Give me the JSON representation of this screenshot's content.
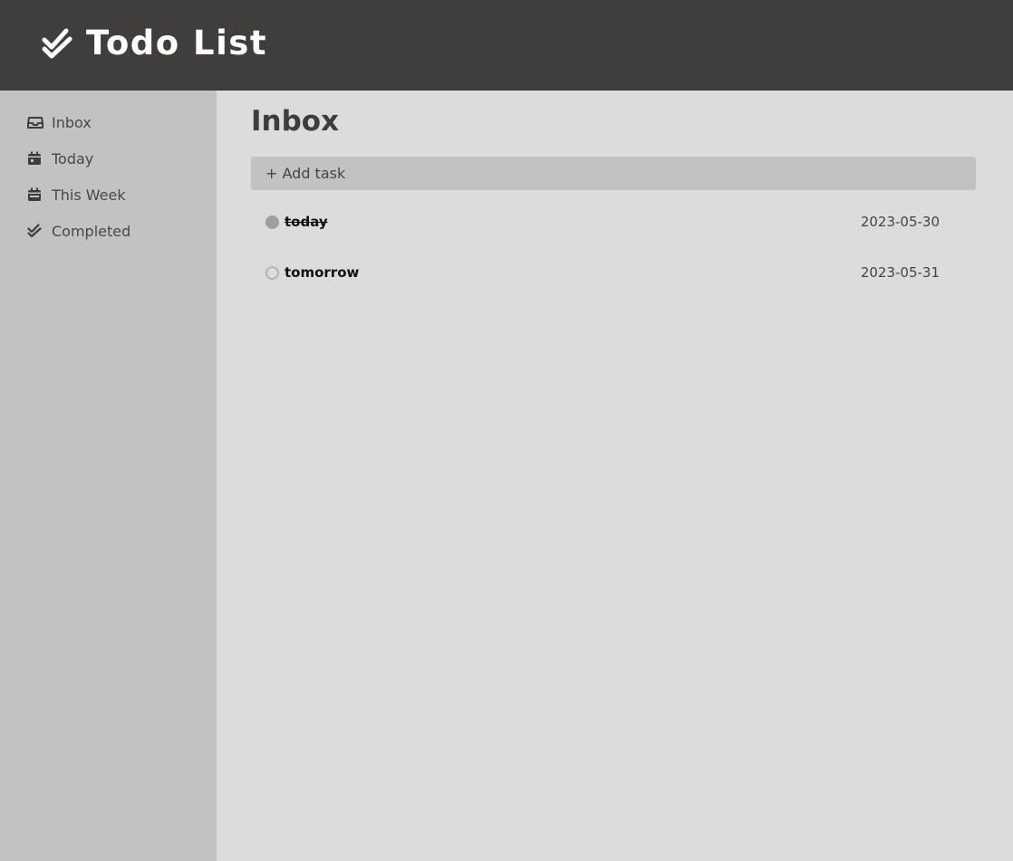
{
  "app": {
    "title": "Todo List",
    "logo_icon": "double-check-icon"
  },
  "sidebar": {
    "items": [
      {
        "label": "Inbox",
        "icon": "inbox-icon"
      },
      {
        "label": "Today",
        "icon": "calendar-day-icon"
      },
      {
        "label": "This Week",
        "icon": "calendar-week-icon"
      },
      {
        "label": "Completed",
        "icon": "double-check-icon"
      }
    ]
  },
  "main": {
    "title": "Inbox",
    "add_task_label": "+ Add task",
    "tasks": [
      {
        "name": "today",
        "date": "2023-05-30",
        "completed": true
      },
      {
        "name": "tomorrow",
        "date": "2023-05-31",
        "completed": false
      }
    ]
  },
  "colors": {
    "header_bg": "#403e3c",
    "sidebar_bg": "#c2c2c2",
    "main_bg": "#dcdcdc",
    "text_dark": "#3f3d3b"
  }
}
